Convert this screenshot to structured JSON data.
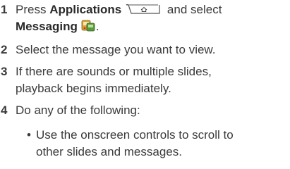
{
  "steps": [
    {
      "number": "1",
      "pre": "Press ",
      "bold1": "Applications",
      "mid": " and select",
      "bold2": "Messaging",
      "post": "."
    },
    {
      "number": "2",
      "line1": "Select the message you want to view."
    },
    {
      "number": "3",
      "line1": "If there are sounds or multiple slides,",
      "line2": "playback begins immediately."
    },
    {
      "number": "4",
      "line1": "Do any of the following:"
    }
  ],
  "bullets": [
    {
      "symbol": "•",
      "line1": "Use the onscreen controls to scroll to",
      "line2": "other slides and messages."
    }
  ],
  "icons": {
    "applications_key": "home-key-icon",
    "messaging_app": "messaging-app-icon"
  }
}
